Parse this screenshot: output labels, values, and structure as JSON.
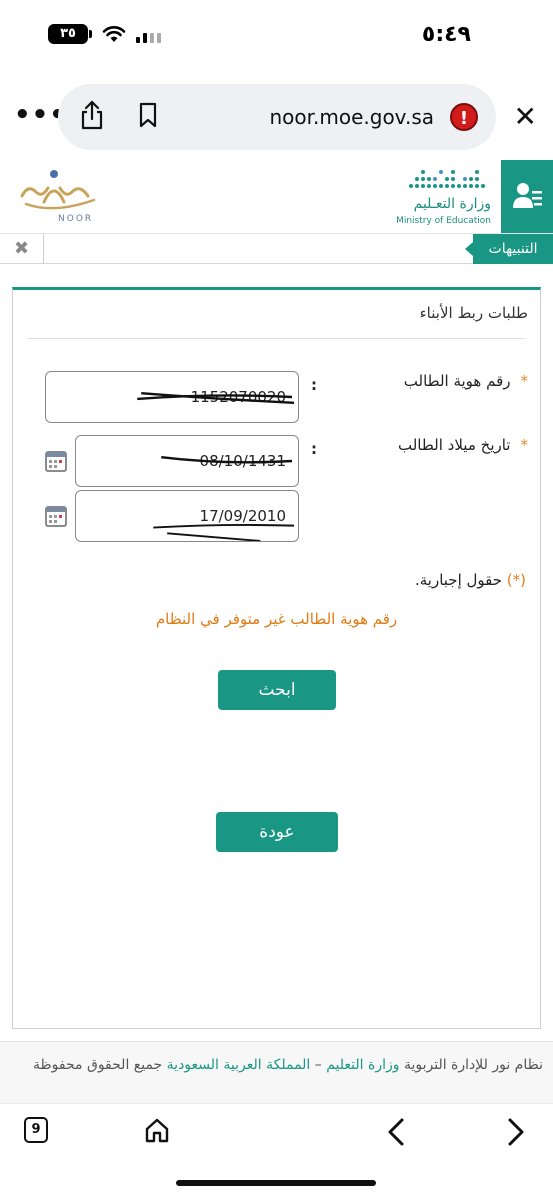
{
  "status_bar": {
    "time": "٥:٤٩",
    "battery": "٣٥"
  },
  "browser": {
    "url": "noor.moe.gov.sa",
    "tabs_count": "9"
  },
  "header": {
    "noor_text": "NOOR",
    "ministry_ar": "وزارة التعـليم",
    "ministry_en": "Ministry of Education"
  },
  "notifications": {
    "label": "التنبيهات"
  },
  "form": {
    "title": "طلبات ربط الأبناء",
    "required_star": "*",
    "colon": ":",
    "student_id_label": "رقم هوية الطالب",
    "student_id_value": "1152070020",
    "birth_date_label": "تاريخ ميلاد الطالب",
    "hijri_date_value": "08/10/1431",
    "gregorian_date_value": "17/09/2010",
    "mandatory_star": "(*)",
    "mandatory_note": " حقول إجبارية.",
    "error_message": "رقم هوية الطالب غير متوفر في النظام",
    "search_button": "ابحث",
    "back_button": "عودة"
  },
  "footer": {
    "text_start": "نظام نور للإدارة التربوية ",
    "link_ministry": "وزارة التعليم",
    "dash": " – ",
    "link_kingdom": "المملكة العربية السعودية",
    "text_end": " جميع الحقوق محفوظة"
  },
  "colors": {
    "accent": "#1a9784",
    "error": "#e07b12",
    "required": "#e08a1e"
  }
}
